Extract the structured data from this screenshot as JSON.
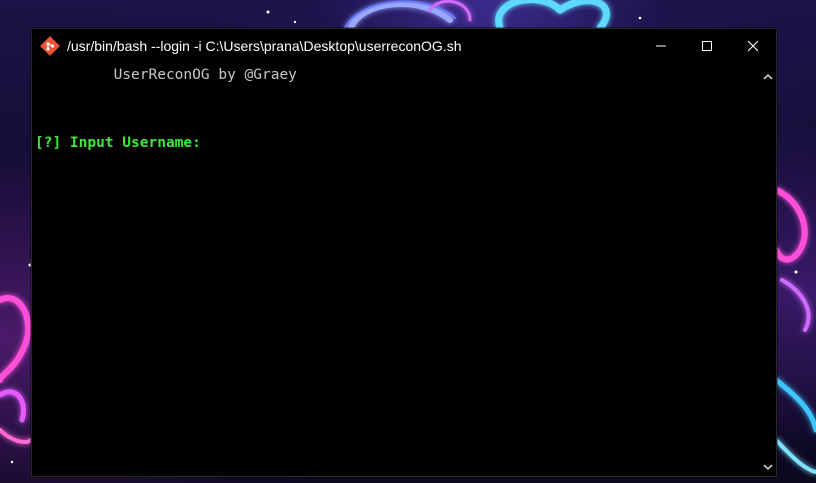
{
  "window": {
    "title": "/usr/bin/bash --login -i C:\\Users\\prana\\Desktop\\userreconOG.sh",
    "app_icon": "git-bash-icon",
    "controls": [
      "minimize-icon",
      "maximize-icon",
      "close-icon"
    ]
  },
  "terminal": {
    "banner": "UserReconOG by @Graey",
    "banner_indent": "         ",
    "prompt": "[?] Input Username:",
    "banner_color": "#c8c8c8",
    "prompt_color": "#3be83b",
    "background": "#000000"
  },
  "scrollbar": {
    "up_icon": "chevron-up-icon",
    "down_icon": "chevron-down-icon"
  }
}
